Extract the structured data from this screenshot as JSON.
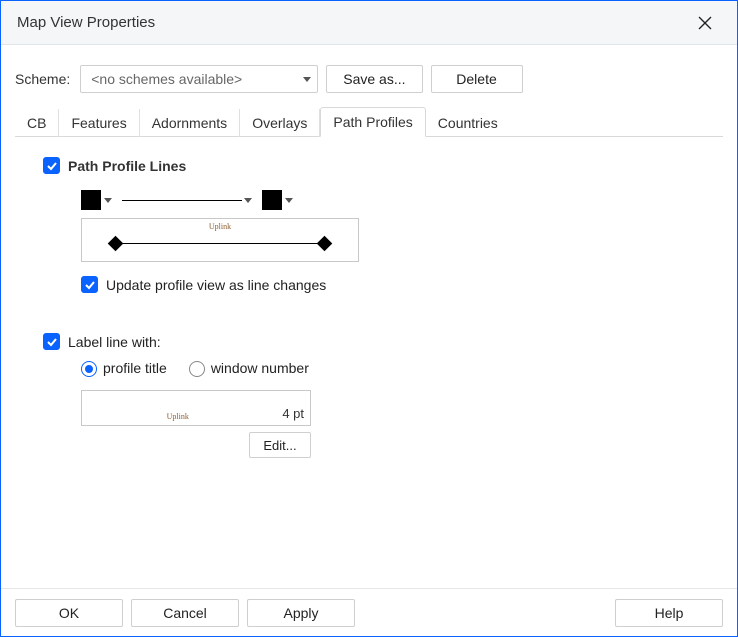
{
  "window": {
    "title": "Map View Properties"
  },
  "scheme": {
    "label": "Scheme:",
    "selection": "<no schemes available>",
    "save_as_label": "Save as...",
    "delete_label": "Delete"
  },
  "tabs": [
    "CB",
    "Features",
    "Adornments",
    "Overlays",
    "Path Profiles",
    "Countries"
  ],
  "path_profiles": {
    "section_title": "Path Profile Lines",
    "preview_caption": "Uplink",
    "update_caption": "Update profile view as line changes",
    "label_line_with": "Label line with:",
    "radio_profile_title": "profile title",
    "radio_window_number": "window number",
    "label_caption": "Uplink",
    "pt_value": "4 pt",
    "edit_label": "Edit..."
  },
  "footer": {
    "ok": "OK",
    "cancel": "Cancel",
    "apply": "Apply",
    "help": "Help"
  }
}
